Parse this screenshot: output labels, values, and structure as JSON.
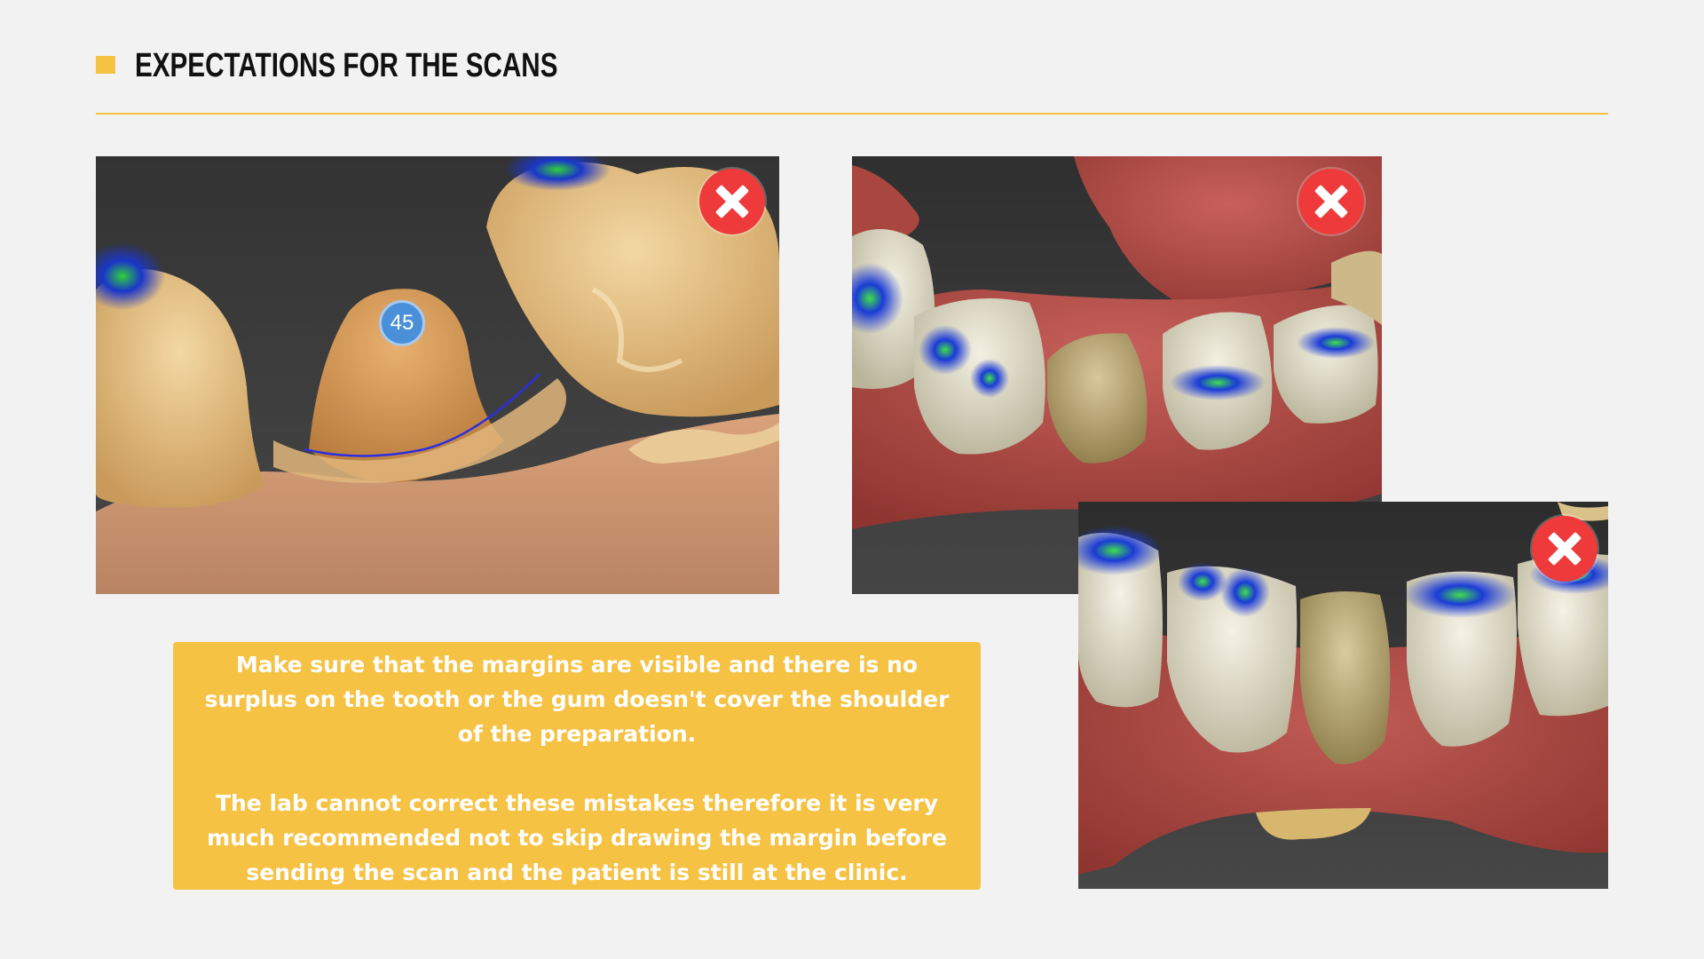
{
  "header": {
    "title": "EXPECTATIONS FOR THE SCANS"
  },
  "colors": {
    "accent": "#f6c244",
    "background": "#f2f2f2",
    "error_red": "#ee3a3a",
    "scan_background": "#3d3d3d",
    "tooth_tag_blue": "#4a90d9"
  },
  "scans": [
    {
      "status_icon": "error-x-icon",
      "tooth_tag": "45"
    },
    {
      "status_icon": "error-x-icon"
    },
    {
      "status_icon": "error-x-icon"
    }
  ],
  "note": {
    "paragraph_1": "Make sure that the margins are visible and there is no surplus on the tooth or the gum doesn't cover the shoulder of the preparation.",
    "paragraph_2": "The lab cannot correct these mistakes therefore it is very much recommended not to skip drawing the margin before sending the scan and the patient is still at the clinic."
  }
}
